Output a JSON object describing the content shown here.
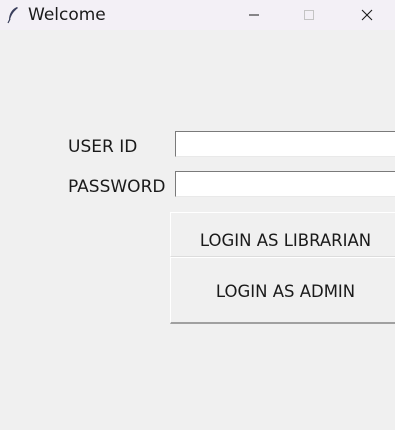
{
  "window": {
    "title": "Welcome",
    "icon": "feather-icon",
    "controls": [
      "minimize-icon",
      "maximize-icon",
      "close-icon"
    ]
  },
  "form": {
    "user_id_label": "USER ID",
    "user_id_value": "",
    "password_label": "PASSWORD",
    "password_value": ""
  },
  "buttons": {
    "librarian_label": "LOGIN AS LIBRARIAN",
    "admin_label": "LOGIN AS ADMIN"
  }
}
